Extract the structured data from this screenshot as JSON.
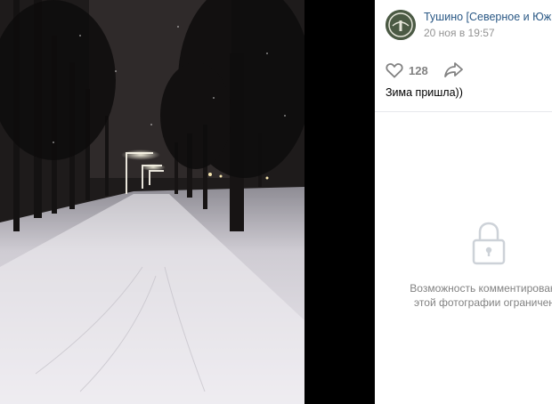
{
  "post": {
    "group_name": "Тушино [Северное и Южное]",
    "date": "20 ноя в 19:57",
    "caption": "Зима пришла))"
  },
  "actions": {
    "like_icon": "heart-icon",
    "like_count": "128",
    "share_icon": "share-arrow-icon"
  },
  "comments": {
    "lock_icon": "lock-icon",
    "restricted_text": "Возможность комментирования этой фотографии ограничена."
  },
  "colors": {
    "link": "#2a5885",
    "muted": "#939393",
    "icon": "#828282"
  }
}
